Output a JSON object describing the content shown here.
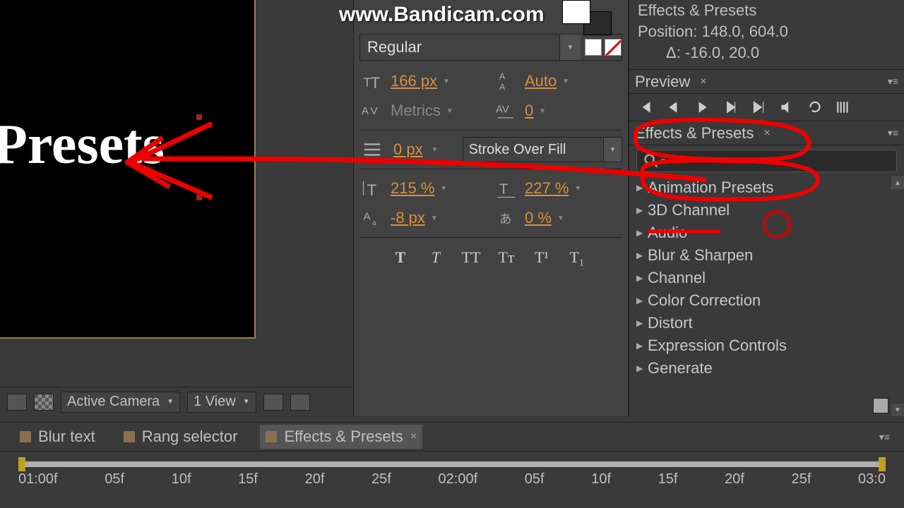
{
  "watermark": "www.Bandicam.com",
  "info": {
    "title": "Effects & Presets",
    "position": "Position: 148.0, 604.0",
    "delta": "Δ: -16.0, 20.0"
  },
  "viewport_text": "Presets",
  "char": {
    "font_style": "Regular",
    "size": "166 px",
    "leading": "Auto",
    "kerning": "Metrics",
    "tracking": "0",
    "stroke_width": "0 px",
    "stroke_order": "Stroke Over Fill",
    "vscale": "215 %",
    "hscale": "227 %",
    "baseline": "-8 px",
    "tsume": "0 %"
  },
  "styles": {
    "bold": "T",
    "italic": "T",
    "allcaps": "TT",
    "smallcaps": "Tᴛ",
    "super": "T¹",
    "sub": "T₁"
  },
  "preview": {
    "title": "Preview"
  },
  "effects": {
    "title": "Effects & Presets",
    "search_placeholder": "",
    "items": [
      "Animation Presets",
      "3D Channel",
      "Audio",
      "Blur & Sharpen",
      "Channel",
      "Color Correction",
      "Distort",
      "Expression Controls",
      "Generate"
    ]
  },
  "viewer": {
    "camera": "Active Camera",
    "views": "1 View"
  },
  "tabs": [
    {
      "label": "Blur text"
    },
    {
      "label": "Rang selector"
    },
    {
      "label": "Effects & Presets",
      "active": true
    }
  ],
  "ticks": [
    "01:00f",
    "05f",
    "10f",
    "15f",
    "20f",
    "25f",
    "02:00f",
    "05f",
    "10f",
    "15f",
    "20f",
    "25f",
    "03:0"
  ]
}
